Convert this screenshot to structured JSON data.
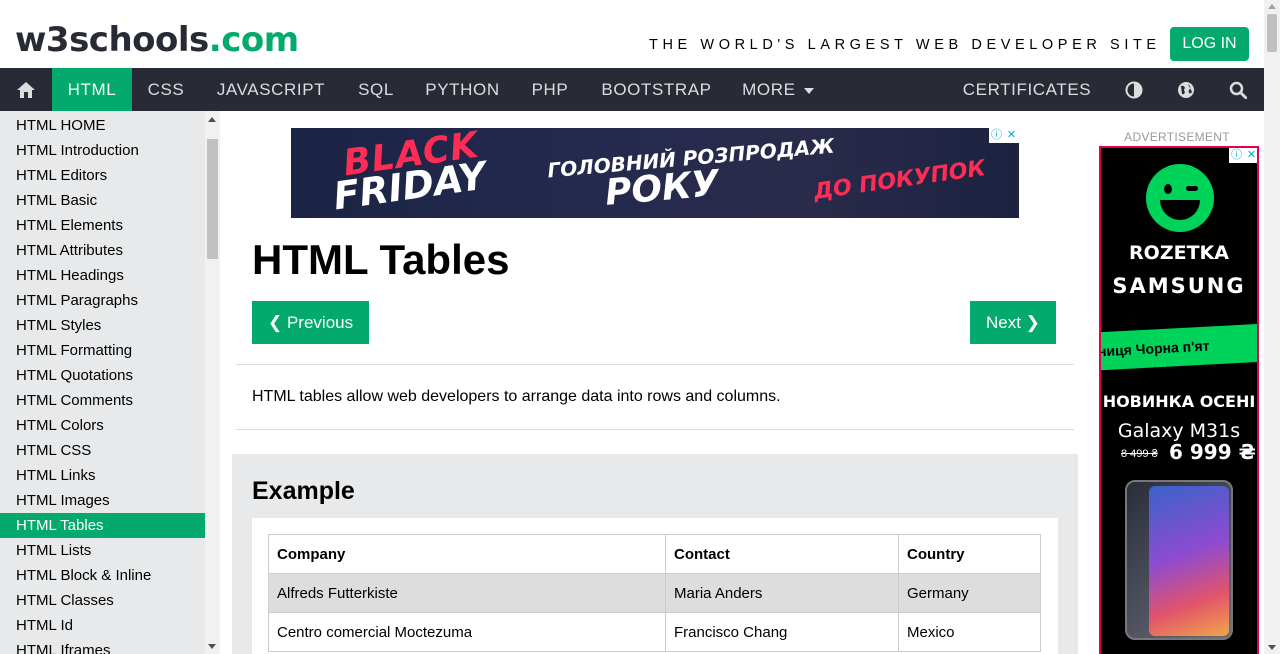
{
  "header": {
    "logo_part1": "w3schools",
    "logo_part2": ".com",
    "tagline": "THE WORLD'S LARGEST WEB DEVELOPER SITE",
    "login_label": "LOG IN"
  },
  "nav": {
    "items": [
      {
        "label": "HTML",
        "active": true
      },
      {
        "label": "CSS"
      },
      {
        "label": "JAVASCRIPT"
      },
      {
        "label": "SQL"
      },
      {
        "label": "PYTHON"
      },
      {
        "label": "PHP"
      },
      {
        "label": "BOOTSTRAP"
      },
      {
        "label": "MORE"
      }
    ],
    "certificates": "CERTIFICATES",
    "icons": [
      "home-icon",
      "contrast-icon",
      "globe-icon",
      "search-icon"
    ]
  },
  "sidebar": {
    "items": [
      "HTML HOME",
      "HTML Introduction",
      "HTML Editors",
      "HTML Basic",
      "HTML Elements",
      "HTML Attributes",
      "HTML Headings",
      "HTML Paragraphs",
      "HTML Styles",
      "HTML Formatting",
      "HTML Quotations",
      "HTML Comments",
      "HTML Colors",
      "HTML CSS",
      "HTML Links",
      "HTML Images",
      "HTML Tables",
      "HTML Lists",
      "HTML Block & Inline",
      "HTML Classes",
      "HTML Id",
      "HTML Iframes"
    ],
    "active_index": 16
  },
  "main": {
    "ad": {
      "line1": "BLACK",
      "line2": "FRIDAY",
      "line3": "ГОЛОВНИЙ РОЗПРОДАЖ",
      "line4": "РОКУ",
      "line5": "ДО ПОКУПОК",
      "badge_info": "ⓘ",
      "badge_close": "✕"
    },
    "title": "HTML Tables",
    "prev_label": "❮ Previous",
    "next_label": "Next ❯",
    "intro": "HTML tables allow web developers to arrange data into rows and columns.",
    "example": {
      "title": "Example",
      "headers": [
        "Company",
        "Contact",
        "Country"
      ],
      "rows": [
        [
          "Alfreds Futterkiste",
          "Maria Anders",
          "Germany"
        ],
        [
          "Centro comercial Moctezuma",
          "Francisco Chang",
          "Mexico"
        ]
      ]
    }
  },
  "right_ad": {
    "label": "ADVERTISEMENT",
    "brand1": "ROZETKA",
    "brand2": "SAMSUNG",
    "ribbon": "тниця   Чорна п'ят",
    "headline": "НОВИНКА ОСЕНІ",
    "model": "Galaxy M31s",
    "old_price": "8 499 ₴",
    "price": "6 999 ₴"
  },
  "colors": {
    "accent": "#04aa6d",
    "nav_bg": "#282a35",
    "sidebar_bg": "#e7e9eb"
  }
}
